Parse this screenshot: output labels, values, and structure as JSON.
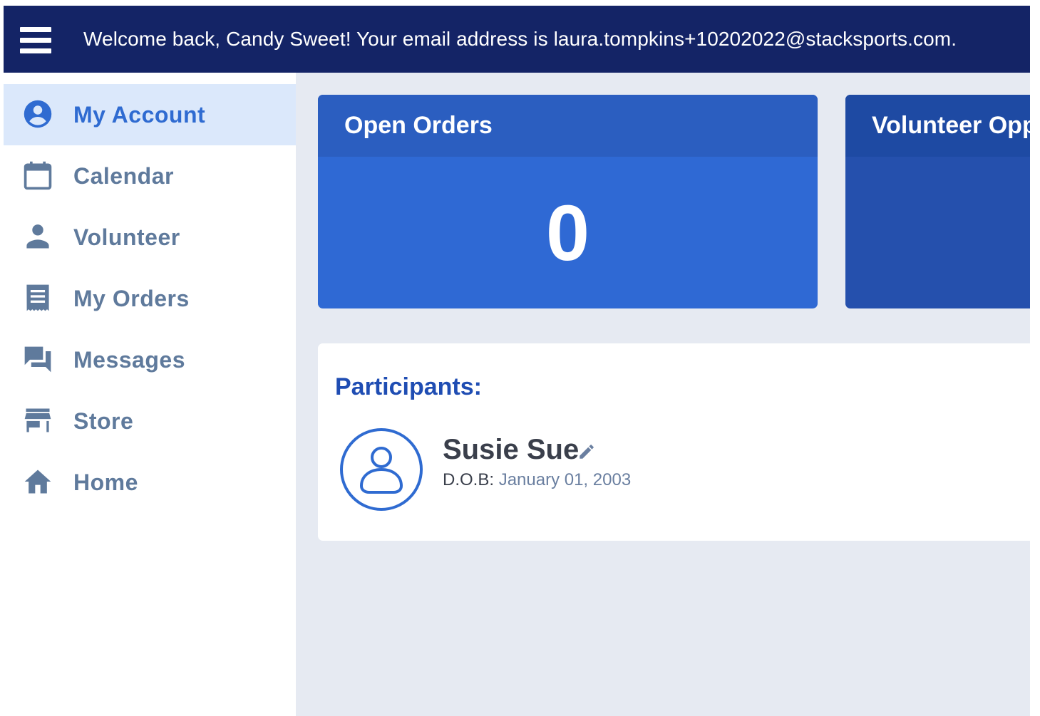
{
  "header": {
    "welcome_text": "Welcome back, Candy Sweet! Your email address is laura.tompkins+10202022@stacksports.com.",
    "menu_icon": "hamburger-menu-icon"
  },
  "sidebar": {
    "items": [
      {
        "label": "My Account",
        "icon": "account-circle-icon",
        "active": true
      },
      {
        "label": "Calendar",
        "icon": "calendar-icon",
        "active": false
      },
      {
        "label": "Volunteer",
        "icon": "person-icon",
        "active": false
      },
      {
        "label": "My Orders",
        "icon": "receipt-icon",
        "active": false
      },
      {
        "label": "Messages",
        "icon": "forum-icon",
        "active": false
      },
      {
        "label": "Store",
        "icon": "store-icon",
        "active": false
      },
      {
        "label": "Home",
        "icon": "home-icon",
        "active": false
      }
    ]
  },
  "cards": {
    "open_orders": {
      "title": "Open Orders",
      "count": "0"
    },
    "volunteer": {
      "title": "Volunteer Oppor"
    }
  },
  "participants": {
    "title": "Participants:",
    "items": [
      {
        "name": "Susie Sue",
        "dob_label": "D.O.B:",
        "dob_value": "January 01, 2003"
      }
    ]
  },
  "colors": {
    "topbar": "#142466",
    "accent": "#2f6bd1",
    "card_blue": "#2f69d4",
    "background": "#e6eaf2"
  }
}
